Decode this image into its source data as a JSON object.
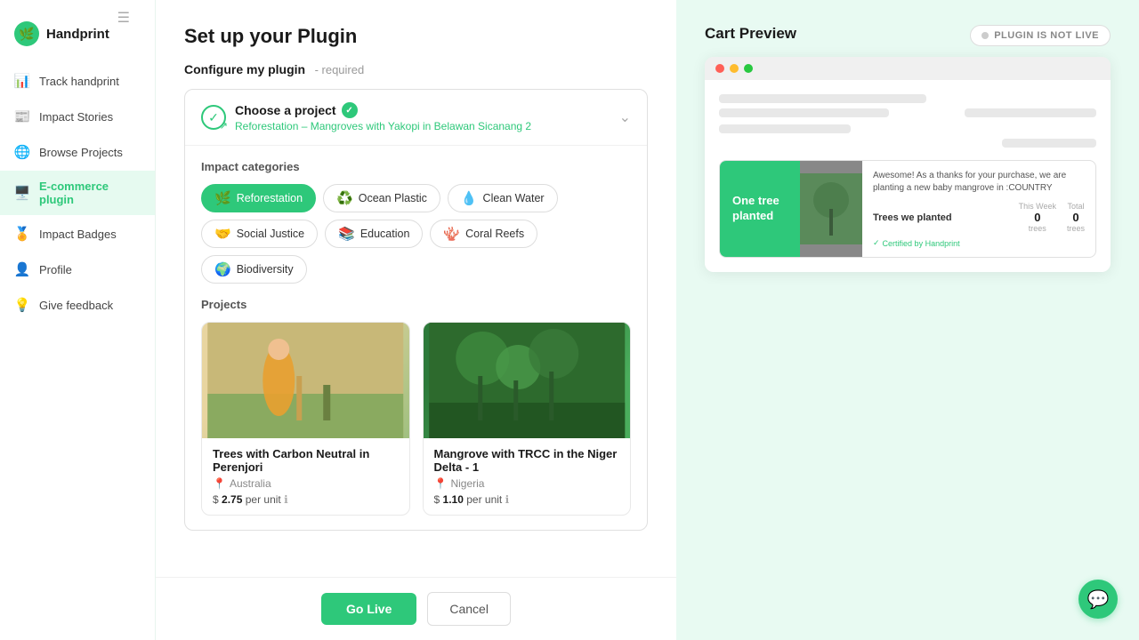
{
  "app": {
    "logo_icon": "🌿",
    "logo_text": "Handprint"
  },
  "sidebar": {
    "items": [
      {
        "id": "track",
        "icon": "📊",
        "label": "Track handprint",
        "active": false
      },
      {
        "id": "stories",
        "icon": "📰",
        "label": "Impact Stories",
        "active": false
      },
      {
        "id": "browse",
        "icon": "🌐",
        "label": "Browse Projects",
        "active": false
      },
      {
        "id": "ecommerce",
        "icon": "🖥️",
        "label": "E-commerce plugin",
        "active": true
      },
      {
        "id": "badges",
        "icon": "🏅",
        "label": "Impact Badges",
        "active": false
      },
      {
        "id": "profile",
        "icon": "👤",
        "label": "Profile",
        "active": false
      },
      {
        "id": "feedback",
        "icon": "💡",
        "label": "Give feedback",
        "active": false
      }
    ]
  },
  "main": {
    "page_title": "Set up your Plugin",
    "configure_label": "Configure my plugin",
    "configure_required": "- required",
    "choose_project": {
      "title": "Choose a project",
      "subtitle": "Reforestation – Mangroves with Yakopi in Belawan Sicanang 2"
    },
    "impact_categories": {
      "title": "Impact categories",
      "items": [
        {
          "id": "reforestation",
          "icon": "🌿",
          "label": "Reforestation",
          "active": true
        },
        {
          "id": "ocean-plastic",
          "icon": "♻️",
          "label": "Ocean Plastic",
          "active": false
        },
        {
          "id": "clean-water",
          "icon": "💧",
          "label": "Clean Water",
          "active": false
        },
        {
          "id": "social-justice",
          "icon": "🤝",
          "label": "Social Justice",
          "active": false
        },
        {
          "id": "education",
          "icon": "📚",
          "label": "Education",
          "active": false
        },
        {
          "id": "coral-reefs",
          "icon": "🪸",
          "label": "Coral Reefs",
          "active": false
        },
        {
          "id": "biodiversity",
          "icon": "🌍",
          "label": "Biodiversity",
          "active": false
        }
      ]
    },
    "projects": {
      "title": "Projects",
      "items": [
        {
          "id": "proj1",
          "name": "Trees with Carbon Neutral in Perenjori",
          "location": "Australia",
          "price": "2.75",
          "unit": "per unit"
        },
        {
          "id": "proj2",
          "name": "Mangrove with TRCC in the Niger Delta - 1",
          "location": "Nigeria",
          "price": "1.10",
          "unit": "per unit"
        }
      ]
    }
  },
  "footer": {
    "go_live_label": "Go Live",
    "cancel_label": "Cancel"
  },
  "right_panel": {
    "title": "Cart Preview",
    "plugin_status": "PLUGIN IS NOT LIVE",
    "widget": {
      "green_text_line1": "One tree",
      "green_text_line2": "planted",
      "message": "Awesome! As a thanks for your purchase, we are planting a new baby mangrove in :COUNTRY",
      "trees_label": "Trees we planted",
      "this_week_label": "This Week",
      "this_week_value": "0",
      "this_week_unit": "trees",
      "total_label": "Total",
      "total_value": "0",
      "total_unit": "trees",
      "certified_text": "Certified by Handprint"
    }
  }
}
